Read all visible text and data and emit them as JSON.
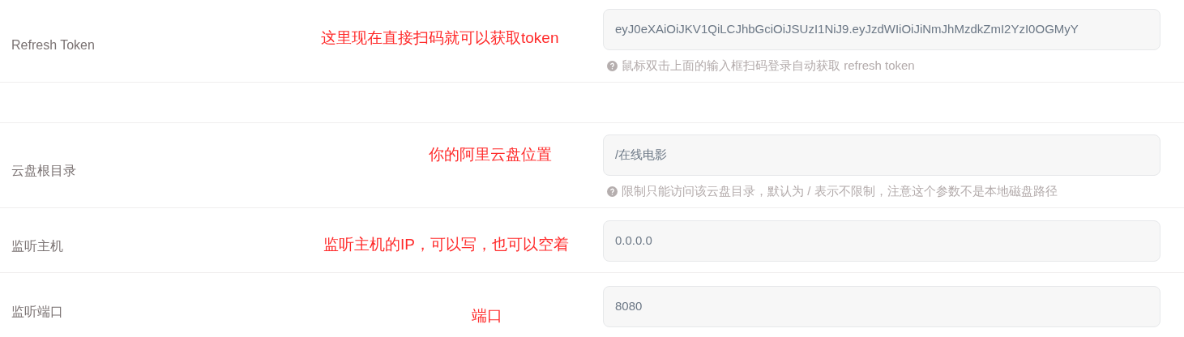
{
  "rows": [
    {
      "kind": "field",
      "label": "Refresh Token",
      "value": "eyJ0eXAiOiJKV1QiLCJhbGciOiJSUzI1NiJ9.eyJzdWIiOiJiNmJhMzdkZmI2YzI0OGMyY",
      "help": "鼠标双击上面的输入框扫码登录自动获取 refresh token",
      "note": "这里现在直接扫码就可以获取token"
    },
    {
      "kind": "spacer"
    },
    {
      "kind": "field",
      "label": "云盘根目录",
      "value": "/在线电影",
      "help": "限制只能访问该云盘目录，默认为 / 表示不限制，注意这个参数不是本地磁盘路径",
      "note": "你的阿里云盘位置"
    },
    {
      "kind": "field",
      "label": "监听主机",
      "value": "0.0.0.0",
      "note": "监听主机的IP，可以写，也可以空着"
    },
    {
      "kind": "field",
      "label": "监听端口",
      "value": "8080",
      "note": "端口"
    }
  ]
}
